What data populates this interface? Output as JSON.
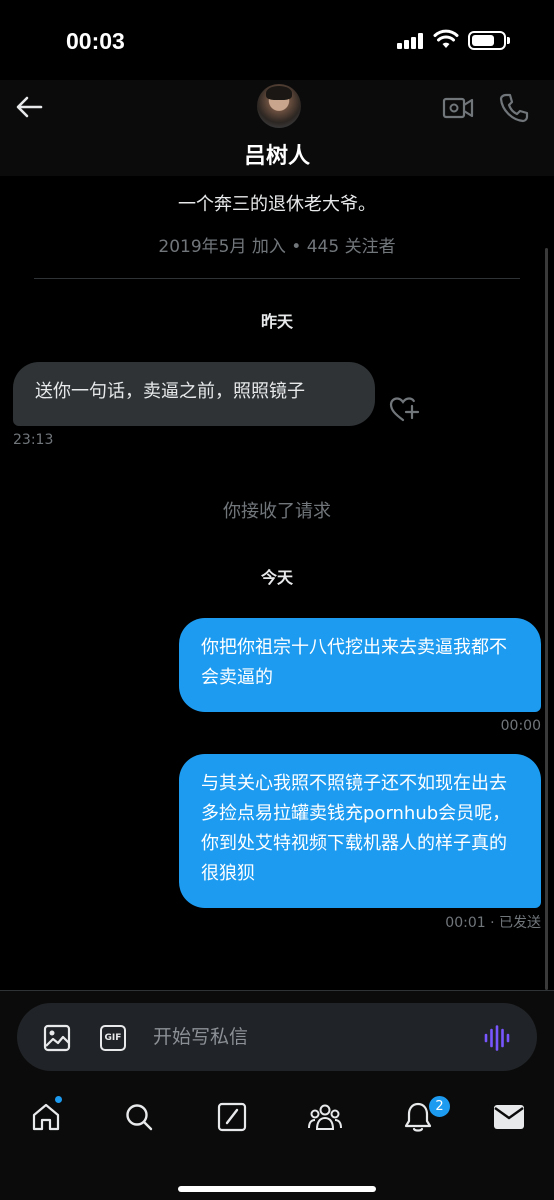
{
  "status_bar": {
    "time": "00:03"
  },
  "header": {
    "contact_name": "吕树人",
    "icons": {
      "back": "arrow-left-icon",
      "video": "video-camera-icon",
      "phone": "phone-icon"
    }
  },
  "profile": {
    "bio": "一个奔三的退休老大爷。",
    "meta": "2019年5月 加入 • 445 关注者"
  },
  "conversation": {
    "day_yesterday": "昨天",
    "incoming_message": {
      "text": "送你一句话，卖逼之前，照照镜子",
      "time": "23:13"
    },
    "system_notice": "你接收了请求",
    "day_today": "今天",
    "outgoing_messages": [
      {
        "text": "你把你祖宗十八代挖出来去卖逼我都不会卖逼的",
        "time": "00:00"
      },
      {
        "text": "与其关心我照不照镜子还不如现在出去多捡点易拉罐卖钱充pornhub会员呢，你到处艾特视频下载机器人的样子真的很狼狈",
        "time": "00:01 · 已发送"
      }
    ]
  },
  "composer": {
    "placeholder": "开始写私信",
    "gif_label": "GIF"
  },
  "tab_bar": {
    "items": [
      "home-icon",
      "search-icon",
      "compose-icon",
      "communities-icon",
      "notifications-icon",
      "messages-icon"
    ],
    "notification_badge": "2"
  },
  "colors": {
    "accent": "#1d9bf0",
    "voice": "#7856ff",
    "bubble_in": "#2f3336"
  }
}
